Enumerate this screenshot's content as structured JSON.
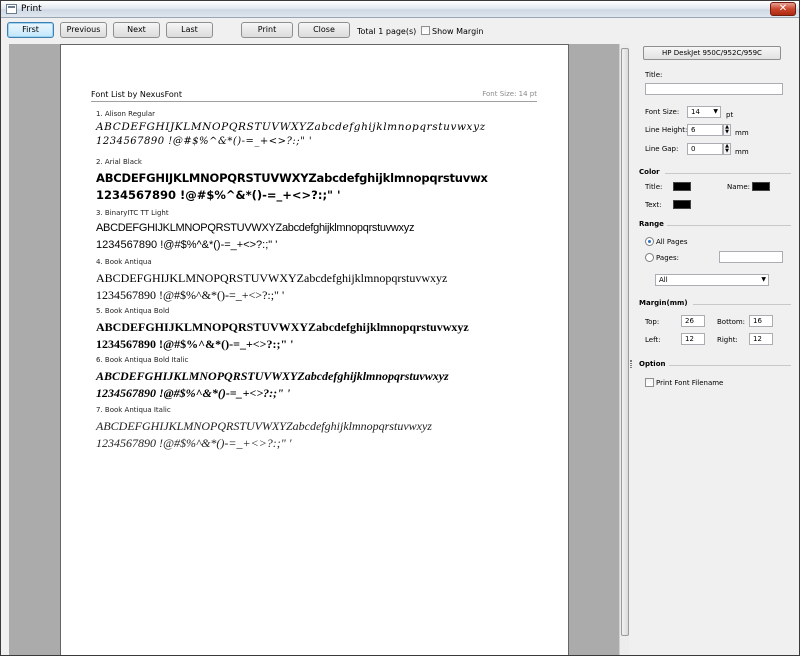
{
  "window": {
    "title": "Print",
    "close_glyph": "✕"
  },
  "toolbar": {
    "first_label": "First",
    "previous_label": "Previous",
    "next_label": "Next",
    "last_label": "Last",
    "print_label": "Print",
    "close_label": "Close",
    "total_text": "Total 1 page(s)",
    "show_margin_label": "Show Margin"
  },
  "page": {
    "title": "Font List by NexusFont",
    "font_size_text": "Font Size:  14 pt",
    "fonts": [
      {
        "label": "1. Alison Regular",
        "line1": "ABCDEFGHIJKLMNOPQRSTUVWXYZabcdefghijklmnopqrstuvwxyz",
        "line2": "1234567890 !@#$%^&*()-=_+<>?:;\" '"
      },
      {
        "label": "2. Arial Black",
        "line1": "ABCDEFGHIJKLMNOPQRSTUVWXYZabcdefghijklmnopqrstuvwx",
        "line2": "1234567890 !@#$%^&*()-=_+<>?:;\" '"
      },
      {
        "label": "3. BinaryITC TT Light",
        "line1": "ABCDEFGHIJKLMNOPQRSTUVWXYZabcdefghijklmnopqrstuvwxyz",
        "line2": "1234567890 !@#$%^&*()-=_+<>?:;\" '"
      },
      {
        "label": "4. Book Antiqua",
        "line1": "ABCDEFGHIJKLMNOPQRSTUVWXYZabcdefghijklmnopqrstuvwxyz",
        "line2": "1234567890 !@#$%^&*()-=_+<>?:;\" '"
      },
      {
        "label": "5. Book Antiqua Bold",
        "line1": "ABCDEFGHIJKLMNOPQRSTUVWXYZabcdefghijklmnopqrstuvwxyz",
        "line2": "1234567890 !@#$%^&*()-=_+<>?:;\" '"
      },
      {
        "label": "6. Book Antiqua Bold Italic",
        "line1": "ABCDEFGHIJKLMNOPQRSTUVWXYZabcdefghijklmnopqrstuvwxyz",
        "line2": "1234567890 !@#$%^&*()-=_+<>?:;\" '"
      },
      {
        "label": "7. Book Antiqua Italic",
        "line1": "ABCDEFGHIJKLMNOPQRSTUVWXYZabcdefghijklmnopqrstuvwxyz",
        "line2": "1234567890 !@#$%^&*()-=_+<>?:;\" '"
      }
    ]
  },
  "panel": {
    "printer_label": "HP DeskJet 950C/952C/959C",
    "title_label": "Title:",
    "title_value": "",
    "font_size_label": "Font Size:",
    "font_size_value": "14",
    "font_size_unit": "pt",
    "line_height_label": "Line Height:",
    "line_height_value": "6",
    "line_height_unit": "mm",
    "line_gap_label": "Line Gap:",
    "line_gap_value": "0",
    "line_gap_unit": "mm",
    "color_section": "Color",
    "color_title_label": "Title:",
    "color_name_label": "Name:",
    "color_text_label": "Text:",
    "range_section": "Range",
    "all_pages_label": "All Pages",
    "pages_label": "Pages:",
    "pages_value": "",
    "range_select_value": "All",
    "margin_section": "Margin(mm)",
    "top_label": "Top:",
    "top_value": "26",
    "bottom_label": "Bottom:",
    "bottom_value": "16",
    "left_label": "Left:",
    "left_value": "12",
    "right_label": "Right:",
    "right_value": "12",
    "option_section": "Option",
    "print_filename_label": "Print Font Filename",
    "swatch_color": "#000000"
  }
}
